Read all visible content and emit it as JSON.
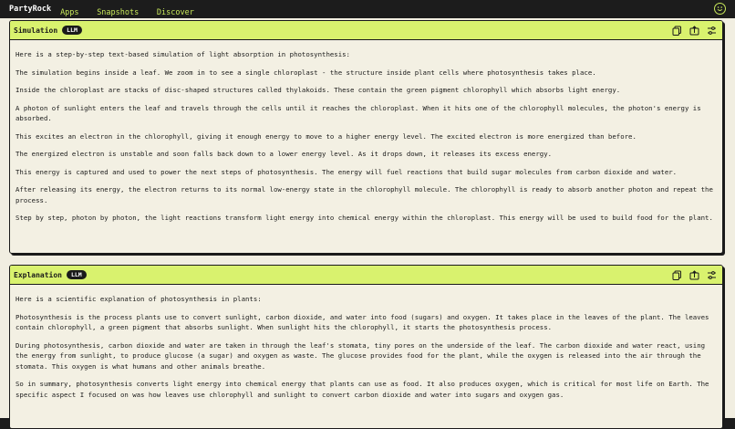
{
  "app": {
    "brand": "PartyRock",
    "nav": [
      "Apps",
      "Snapshots",
      "Discover"
    ]
  },
  "colors": {
    "accent": "#d9f26e",
    "nav_link": "#c8e85a",
    "background": "#f1eee1",
    "topbar": "#1c1c1c"
  },
  "icons": [
    "smiley-face-icon",
    "copy-icon",
    "export-icon",
    "settings-sliders-icon"
  ],
  "panels": [
    {
      "title": "Simulation",
      "badge": "LLM",
      "paragraphs": [
        "Here is a step-by-step text-based simulation of light absorption in photosynthesis:",
        "The simulation begins inside a leaf. We zoom in to see a single chloroplast - the structure inside plant cells where photosynthesis takes place.",
        "Inside the chloroplast are stacks of disc-shaped structures called thylakoids. These contain the green pigment chlorophyll which absorbs light energy.",
        "A photon of sunlight enters the leaf and travels through the cells until it reaches the chloroplast. When it hits one of the chlorophyll molecules, the photon's energy is absorbed.",
        "This excites an electron in the chlorophyll, giving it enough energy to move to a higher energy level. The excited electron is more energized than before.",
        "The energized electron is unstable and soon falls back down to a lower energy level. As it drops down, it releases its excess energy.",
        "This energy is captured and used to power the next steps of photosynthesis. The energy will fuel reactions that build sugar molecules from carbon dioxide and water.",
        "After releasing its energy, the electron returns to its normal low-energy state in the chlorophyll molecule. The chlorophyll is ready to absorb another photon and repeat the process.",
        "Step by step, photon by photon, the light reactions transform light energy into chemical energy within the chloroplast. This energy will be used to build food for the plant."
      ]
    },
    {
      "title": "Explanation",
      "badge": "LLM",
      "paragraphs": [
        "Here is a scientific explanation of photosynthesis in plants:",
        "Photosynthesis is the process plants use to convert sunlight, carbon dioxide, and water into food (sugars) and oxygen. It takes place in the leaves of the plant. The leaves contain chlorophyll, a green pigment that absorbs sunlight. When sunlight hits the chlorophyll, it starts the photosynthesis process.",
        "During photosynthesis, carbon dioxide and water are taken in through the leaf's stomata, tiny pores on the underside of the leaf. The carbon dioxide and water react, using the energy from sunlight, to produce glucose (a sugar) and oxygen as waste. The glucose provides food for the plant, while the oxygen is released into the air through the stomata. This oxygen is what humans and other animals breathe.",
        "So in summary, photosynthesis converts light energy into chemical energy that plants can use as food. It also produces oxygen, which is critical for most life on Earth. The specific aspect I focused on was how leaves use chlorophyll and sunlight to convert carbon dioxide and water into sugars and oxygen gas."
      ]
    }
  ]
}
